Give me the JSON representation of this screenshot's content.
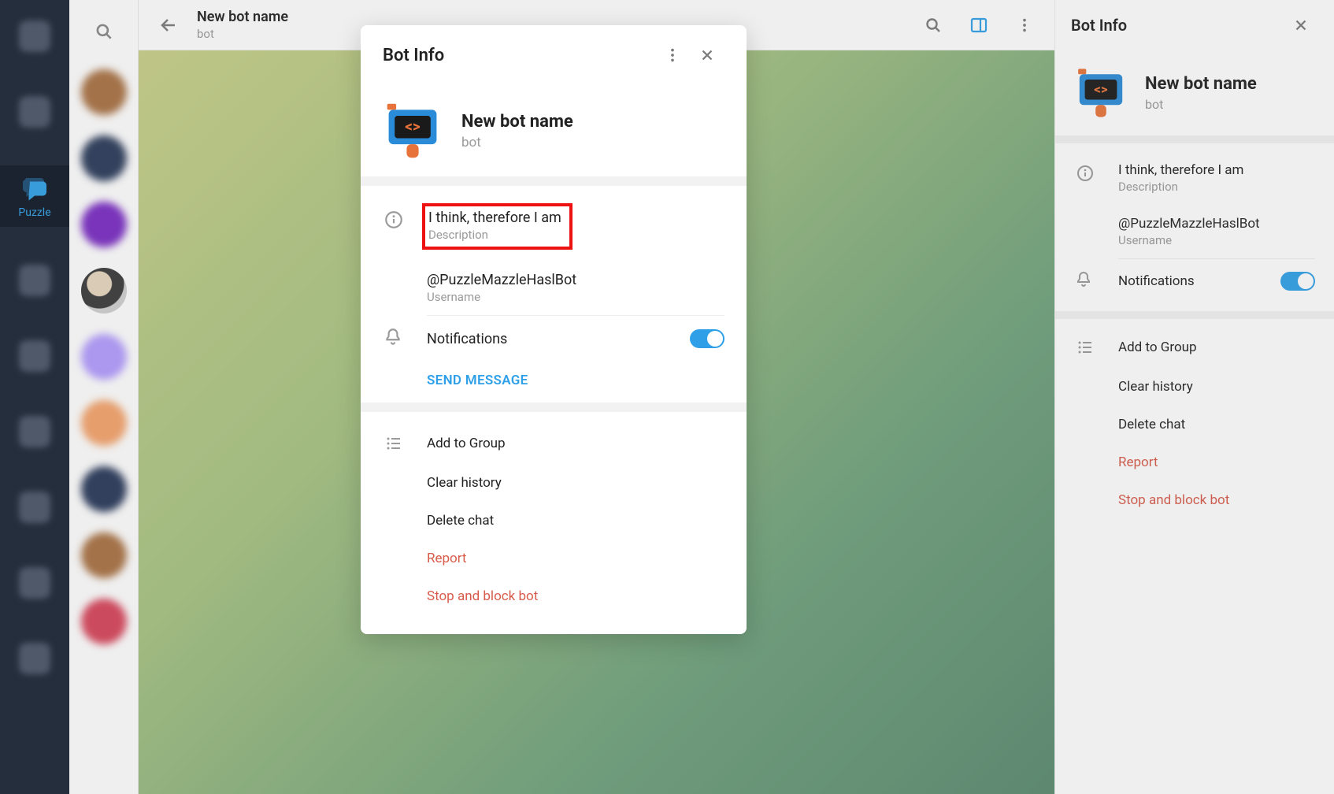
{
  "app_rail": {
    "active_label": "Puzzle"
  },
  "chat_header": {
    "title": "New bot name",
    "subtitle": "bot"
  },
  "side_panel": {
    "title": "Bot Info",
    "profile": {
      "name": "New bot name",
      "subtitle": "bot"
    },
    "description": {
      "value": "I think, therefore I am",
      "label": "Description"
    },
    "username": {
      "value": "@PuzzleMazzleHaslBot",
      "label": "Username"
    },
    "notifications_label": "Notifications",
    "actions": {
      "add_to_group": "Add to Group",
      "clear_history": "Clear history",
      "delete_chat": "Delete chat",
      "report": "Report",
      "stop_block": "Stop and block bot"
    }
  },
  "modal": {
    "title": "Bot Info",
    "profile": {
      "name": "New bot name",
      "subtitle": "bot"
    },
    "description": {
      "value": "I think, therefore I am",
      "label": "Description"
    },
    "username": {
      "value": "@PuzzleMazzleHaslBot",
      "label": "Username"
    },
    "notifications_label": "Notifications",
    "send_message": "SEND MESSAGE",
    "actions": {
      "add_to_group": "Add to Group",
      "clear_history": "Clear history",
      "delete_chat": "Delete chat",
      "report": "Report",
      "stop_block": "Stop and block bot"
    }
  }
}
